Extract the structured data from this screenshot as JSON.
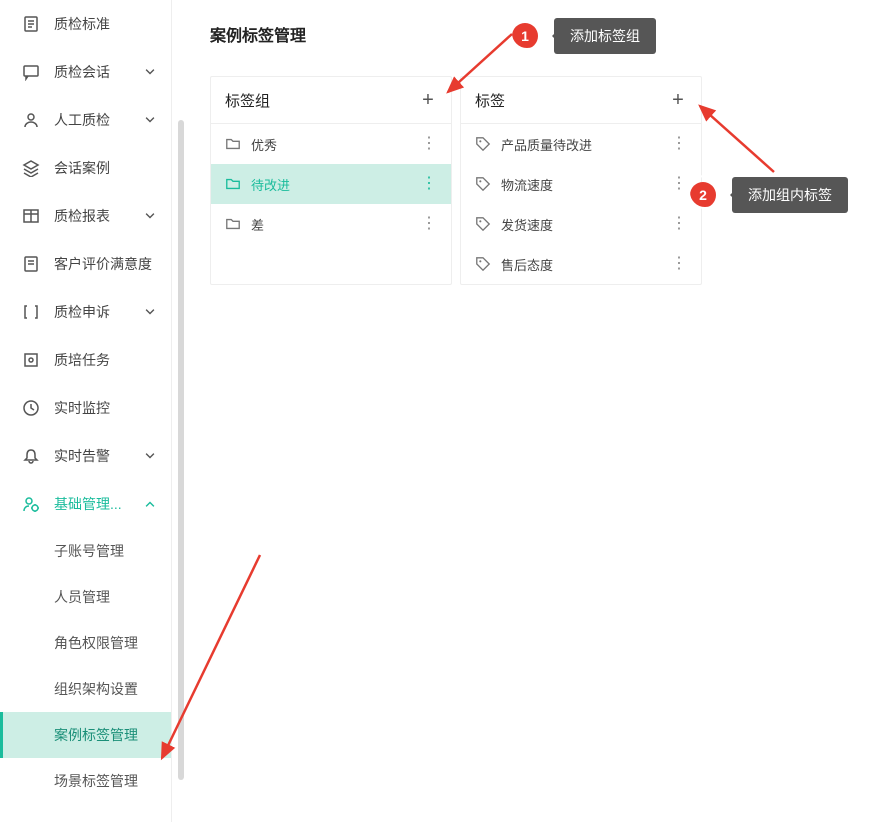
{
  "nav": {
    "items": [
      {
        "label": "质检标准",
        "icon": "doc"
      },
      {
        "label": "质检会话",
        "icon": "chat",
        "chev": "down"
      },
      {
        "label": "人工质检",
        "icon": "user",
        "chev": "down"
      },
      {
        "label": "会话案例",
        "icon": "layers"
      },
      {
        "label": "质检报表",
        "icon": "table",
        "chev": "down"
      },
      {
        "label": "客户评价满意度",
        "icon": "note"
      },
      {
        "label": "质检申诉",
        "icon": "bracket",
        "chev": "down"
      },
      {
        "label": "质培任务",
        "icon": "target"
      },
      {
        "label": "实时监控",
        "icon": "clock"
      },
      {
        "label": "实时告警",
        "icon": "bell",
        "chev": "down"
      },
      {
        "label": "基础管理...",
        "icon": "user-gear",
        "chev": "up",
        "activeParent": true
      }
    ],
    "subItems": [
      {
        "label": "子账号管理"
      },
      {
        "label": "人员管理"
      },
      {
        "label": "角色权限管理"
      },
      {
        "label": "组织架构设置"
      },
      {
        "label": "案例标签管理",
        "active": true
      },
      {
        "label": "场景标签管理"
      }
    ]
  },
  "page": {
    "title": "案例标签管理"
  },
  "groupPanel": {
    "header": "标签组",
    "items": [
      {
        "label": "优秀"
      },
      {
        "label": "待改进",
        "selected": true
      },
      {
        "label": "差"
      }
    ]
  },
  "tagPanel": {
    "header": "标签",
    "items": [
      {
        "label": "产品质量待改进"
      },
      {
        "label": "物流速度"
      },
      {
        "label": "发货速度"
      },
      {
        "label": "售后态度"
      }
    ]
  },
  "callouts": {
    "one": {
      "num": "1",
      "text": "添加标签组"
    },
    "two": {
      "num": "2",
      "text": "添加组内标签"
    }
  }
}
